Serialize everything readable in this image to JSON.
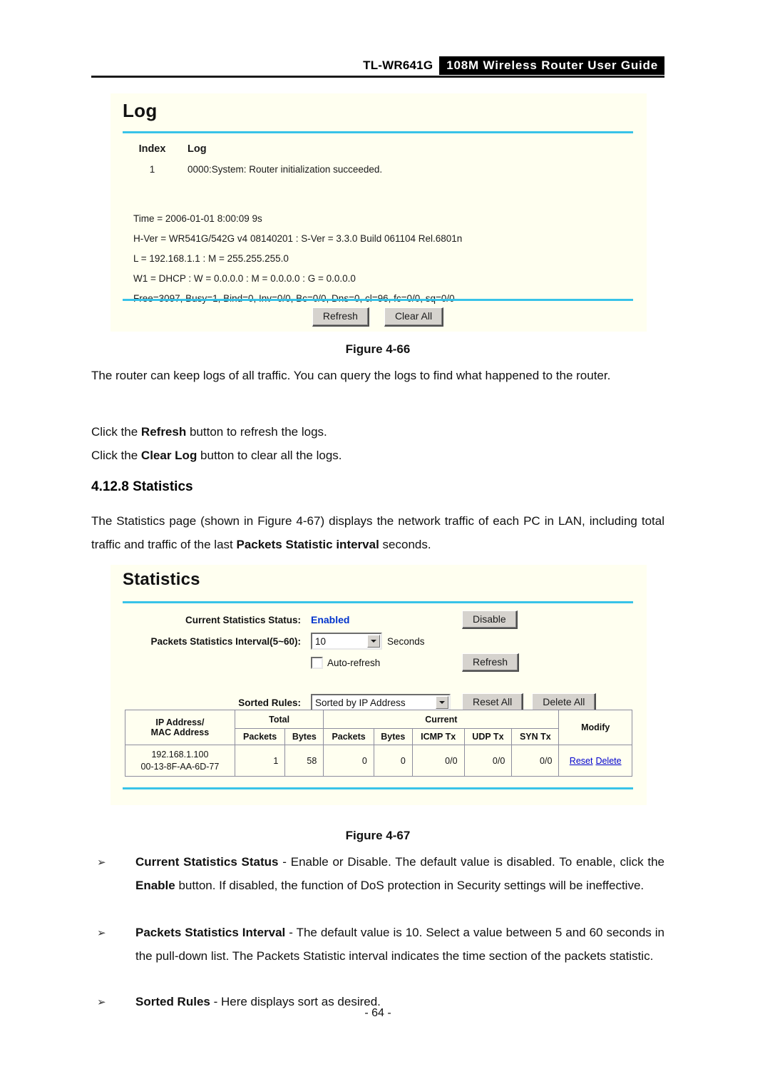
{
  "header": {
    "model": "TL-WR641G",
    "guide_title": "108M Wireless Router User Guide"
  },
  "log_panel": {
    "title": "Log",
    "columns": {
      "index": "Index",
      "log": "Log"
    },
    "rows": [
      {
        "index": "1",
        "message": "0000:System: Router initialization succeeded."
      }
    ],
    "details": [
      "Time = 2006-01-01 8:00:09 9s",
      "H-Ver = WR541G/542G v4 08140201 : S-Ver = 3.3.0 Build 061104 Rel.6801n",
      "L = 192.168.1.1 : M = 255.255.255.0",
      "W1 = DHCP : W = 0.0.0.0 : M = 0.0.0.0 : G = 0.0.0.0",
      "Free=3097, Busy=1, Bind=0, Inv=0/0, Bc=0/0, Dns=0, cl=96, fc=0/0, sq=0/0"
    ],
    "buttons": {
      "refresh": "Refresh",
      "clear_all": "Clear All"
    }
  },
  "figure_66": {
    "caption": "Figure 4-66"
  },
  "log_description": {
    "paragraph": "The router can keep logs of all traffic. You can query the logs to find what happened to the router.",
    "line_refresh_pre": "Click the ",
    "line_refresh_bold": "Refresh",
    "line_refresh_post": " button to refresh the logs.",
    "line_clear_pre": "Click the ",
    "line_clear_bold": "Clear Log",
    "line_clear_post": " button to clear all the logs."
  },
  "statistics_section": {
    "heading_number": "4.12.8",
    "heading_title": "Statistics",
    "intro_part1": "The Statistics page (shown in ",
    "intro_figure_ref": "Figure 4-67",
    "intro_part2": ") displays the network traffic of each PC in LAN, including total traffic and traffic of the last ",
    "intro_bold": "Packets Statistic interval",
    "intro_part3": " seconds."
  },
  "stats_panel": {
    "title": "Statistics",
    "status_label": "Current Statistics Status:",
    "status_value": "Enabled",
    "status_color": "#0033cc",
    "disable_button": "Disable",
    "interval_label": "Packets Statistics Interval(5~60):",
    "interval_value": "10",
    "interval_unit": "Seconds",
    "autorefresh_label": "Auto-refresh",
    "autorefresh_checked": false,
    "refresh_button": "Refresh",
    "sorted_label": "Sorted Rules:",
    "sorted_value": "Sorted by IP Address",
    "reset_all_button": "Reset All",
    "delete_all_button": "Delete All",
    "table": {
      "group_headers": {
        "blank": "",
        "total": "Total",
        "current": "Current",
        "modify": "Modify"
      },
      "columns": [
        "IP Address/\nMAC Address",
        "Packets",
        "Bytes",
        "Packets",
        "Bytes",
        "ICMP Tx",
        "UDP Tx",
        "SYN Tx"
      ],
      "column_host_line1": "IP Address/",
      "column_host_line2": "MAC Address",
      "column_total_packets": "Packets",
      "column_total_bytes": "Bytes",
      "column_current_packets": "Packets",
      "column_current_bytes": "Bytes",
      "column_icmp_tx": "ICMP Tx",
      "column_udp_tx": "UDP Tx",
      "column_syn_tx": "SYN Tx",
      "rows": [
        {
          "ip": "192.168.1.100",
          "mac": "00-13-8F-AA-6D-77",
          "total_packets": "1",
          "total_bytes": "58",
          "current_packets": "0",
          "current_bytes": "0",
          "icmp_tx": "0/0",
          "udp_tx": "0/0",
          "syn_tx": "0/0",
          "reset_link": "Reset",
          "delete_link": "Delete"
        }
      ]
    }
  },
  "figure_67": {
    "caption": "Figure 4-67"
  },
  "bullets": [
    {
      "arrow": "➢",
      "bold": "Current Statistics Status",
      "rest": " - Enable or Disable. The default value is disabled. To enable, click the ",
      "bold2": "Enable",
      "rest2": " button. If disabled, the function of DoS protection in Security settings will be ineffective."
    },
    {
      "arrow": "➢",
      "bold": "Packets Statistics Interval",
      "rest": " - The default value is 10. Select a value between 5 and 60 seconds in the pull-down list. The Packets Statistic interval indicates the time section of the packets statistic."
    },
    {
      "arrow": "➢",
      "bold": "Sorted Rules",
      "rest": " - Here displays sort as desired."
    }
  ],
  "footer": {
    "page_number": "- 64 -"
  }
}
